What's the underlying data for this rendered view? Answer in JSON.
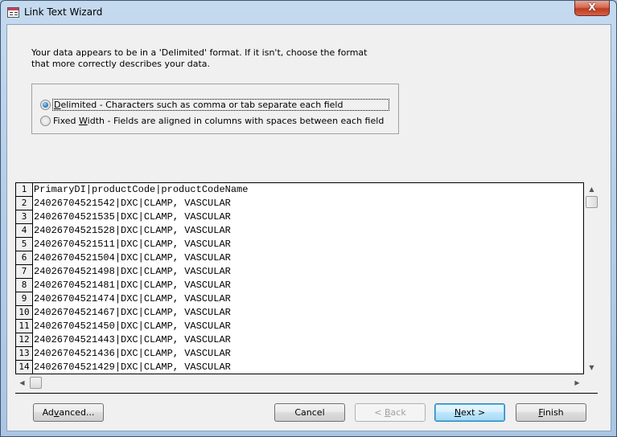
{
  "window": {
    "title": "Link Text Wizard",
    "close_label": "X"
  },
  "intro_text": "Your data appears to be in a 'Delimited' format. If it isn't, choose the format that more correctly describes your data.",
  "format_options": [
    {
      "label_prefix": "",
      "mnemonic": "D",
      "label_rest": "elimited - Characters such as comma or tab separate each field",
      "checked": true
    },
    {
      "label_prefix": "Fixed ",
      "mnemonic": "W",
      "label_rest": "idth - Fields are aligned in columns with spaces between each field",
      "checked": false
    }
  ],
  "preview": {
    "rows": [
      {
        "num": "1",
        "text": "PrimaryDI|productCode|productCodeName"
      },
      {
        "num": "2",
        "text": "24026704521542|DXC|CLAMP, VASCULAR"
      },
      {
        "num": "3",
        "text": "24026704521535|DXC|CLAMP, VASCULAR"
      },
      {
        "num": "4",
        "text": "24026704521528|DXC|CLAMP, VASCULAR"
      },
      {
        "num": "5",
        "text": "24026704521511|DXC|CLAMP, VASCULAR"
      },
      {
        "num": "6",
        "text": "24026704521504|DXC|CLAMP, VASCULAR"
      },
      {
        "num": "7",
        "text": "24026704521498|DXC|CLAMP, VASCULAR"
      },
      {
        "num": "8",
        "text": "24026704521481|DXC|CLAMP, VASCULAR"
      },
      {
        "num": "9",
        "text": "24026704521474|DXC|CLAMP, VASCULAR"
      },
      {
        "num": "10",
        "text": "24026704521467|DXC|CLAMP, VASCULAR"
      },
      {
        "num": "11",
        "text": "24026704521450|DXC|CLAMP, VASCULAR"
      },
      {
        "num": "12",
        "text": "24026704521443|DXC|CLAMP, VASCULAR"
      },
      {
        "num": "13",
        "text": "24026704521436|DXC|CLAMP, VASCULAR"
      },
      {
        "num": "14",
        "text": "24026704521429|DXC|CLAMP, VASCULAR"
      }
    ]
  },
  "buttons": {
    "advanced": {
      "pre": "Ad",
      "mn": "v",
      "post": "anced..."
    },
    "cancel": {
      "pre": "Cancel",
      "mn": "",
      "post": ""
    },
    "back": {
      "pre": "< ",
      "mn": "B",
      "post": "ack",
      "disabled": true
    },
    "next": {
      "pre": "",
      "mn": "N",
      "post": "ext >",
      "default": true
    },
    "finish": {
      "pre": "",
      "mn": "F",
      "post": "inish"
    }
  }
}
